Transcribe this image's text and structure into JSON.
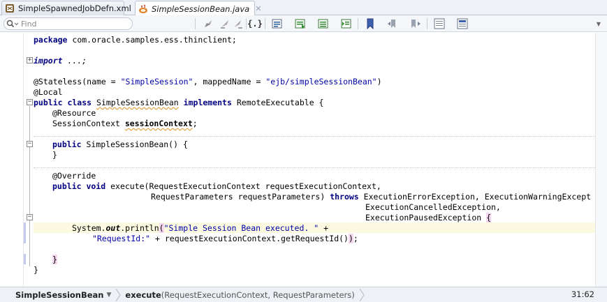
{
  "tabs": [
    {
      "label": "SimpleSpawnedJobDefn.xml",
      "icon": "xml-file-icon",
      "active": false
    },
    {
      "label": "SimpleSessionBean.java",
      "icon": "java-file-icon",
      "active": true
    }
  ],
  "toolbar": {
    "find_placeholder": "Find",
    "buttons": [
      "toggle-breakpoint-icon",
      "previous-breakpoint-icon",
      "next-breakpoint-icon",
      "reformat-code-icon",
      "toggle-comment-icon",
      "surround-with-icon",
      "add-javadoc-icon",
      "bookmark-icon",
      "previous-bookmark-icon",
      "next-bookmark-icon",
      "toggle-line-numbers-icon",
      "show-overview-icon"
    ]
  },
  "code": {
    "line1_kw": "package",
    "line1_rest": " com.oracle.samples.ess.thinclient;",
    "line2_kw": "import",
    "line2_rest": " ...;",
    "line3_a": "@Stateless(name = ",
    "line3_s1": "\"SimpleSession\"",
    "line3_b": ", mappedName = ",
    "line3_s2": "\"ejb/simpleSessionBean\"",
    "line3_c": ")",
    "line4": "@Local",
    "line5_kw1": "public class",
    "line5_name": "SimpleSessionBean",
    "line5_kw2": "implements",
    "line5_rest": " RemoteExecutable {",
    "line6": "@Resource",
    "line7_a": "SessionContext ",
    "line7_b": "sessionContext",
    "line7_c": ";",
    "line8_kw": "public",
    "line8_rest": " SimpleSessionBean() {",
    "line9": "}",
    "line10": "@Override",
    "line11_kw": "public void",
    "line11_rest": " execute(RequestExecutionContext requestExecutionContext,",
    "line12_a": "RequestParameters requestParameters) ",
    "line12_kw": "throws",
    "line12_b": " ExecutionErrorException, ExecutionWarningExcept",
    "line13": "ExecutionCancelledException,",
    "line14_a": "ExecutionPausedException ",
    "line14_b": "{",
    "line15_a": "System.",
    "line15_out": "out",
    "line15_b": ".println",
    "line15_paren": "(",
    "line15_s": "\"Simple Session Bean executed. \"",
    "line15_c": " +",
    "line16_s": "\"RequestId:\"",
    "line16_a": " + requestExecutionContext.getRequestId()",
    "line16_paren": ")",
    "line16_b": ";",
    "line17": "}",
    "line18": "}"
  },
  "statusbar": {
    "class_crumb": "SimpleSessionBean",
    "method_name": "execute",
    "method_sig": "(RequestExecutionContext, RequestParameters)",
    "cursor_position": "31:62"
  }
}
